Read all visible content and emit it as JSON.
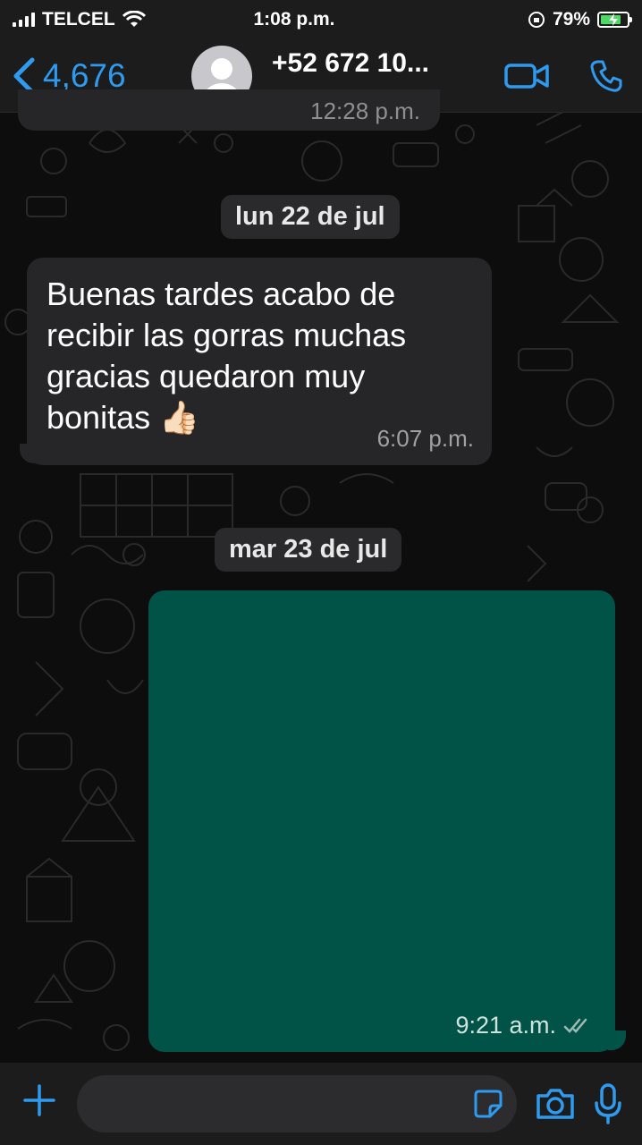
{
  "status_bar": {
    "carrier": "TELCEL",
    "time": "1:08 p.m.",
    "battery": "79%",
    "battery_level": 0.79
  },
  "header": {
    "back_count": "4,676",
    "contact": "+52 672 10...",
    "icons": [
      "chevron-left-icon",
      "avatar",
      "video-call-icon",
      "phone-call-icon"
    ]
  },
  "messages": {
    "top_cut_time": "12:28 p.m.",
    "date1": "lun 22 de jul",
    "incoming_text": "Buenas tardes acabo de recibir las gorras muchas gracias quedaron muy bonitas 👍🏻",
    "incoming_time": "6:07 p.m.",
    "date2": "mar 23 de jul",
    "outgoing_time": "9:21 a.m."
  },
  "input_bar": {
    "placeholder": "",
    "icons": [
      "plus-icon",
      "sticker-icon",
      "camera-icon",
      "microphone-icon"
    ]
  },
  "colors": {
    "accent": "#2f9bf0",
    "incoming_bubble": "#262628",
    "outgoing_bubble": "#015347",
    "bar_bg": "#1c1c1d"
  }
}
